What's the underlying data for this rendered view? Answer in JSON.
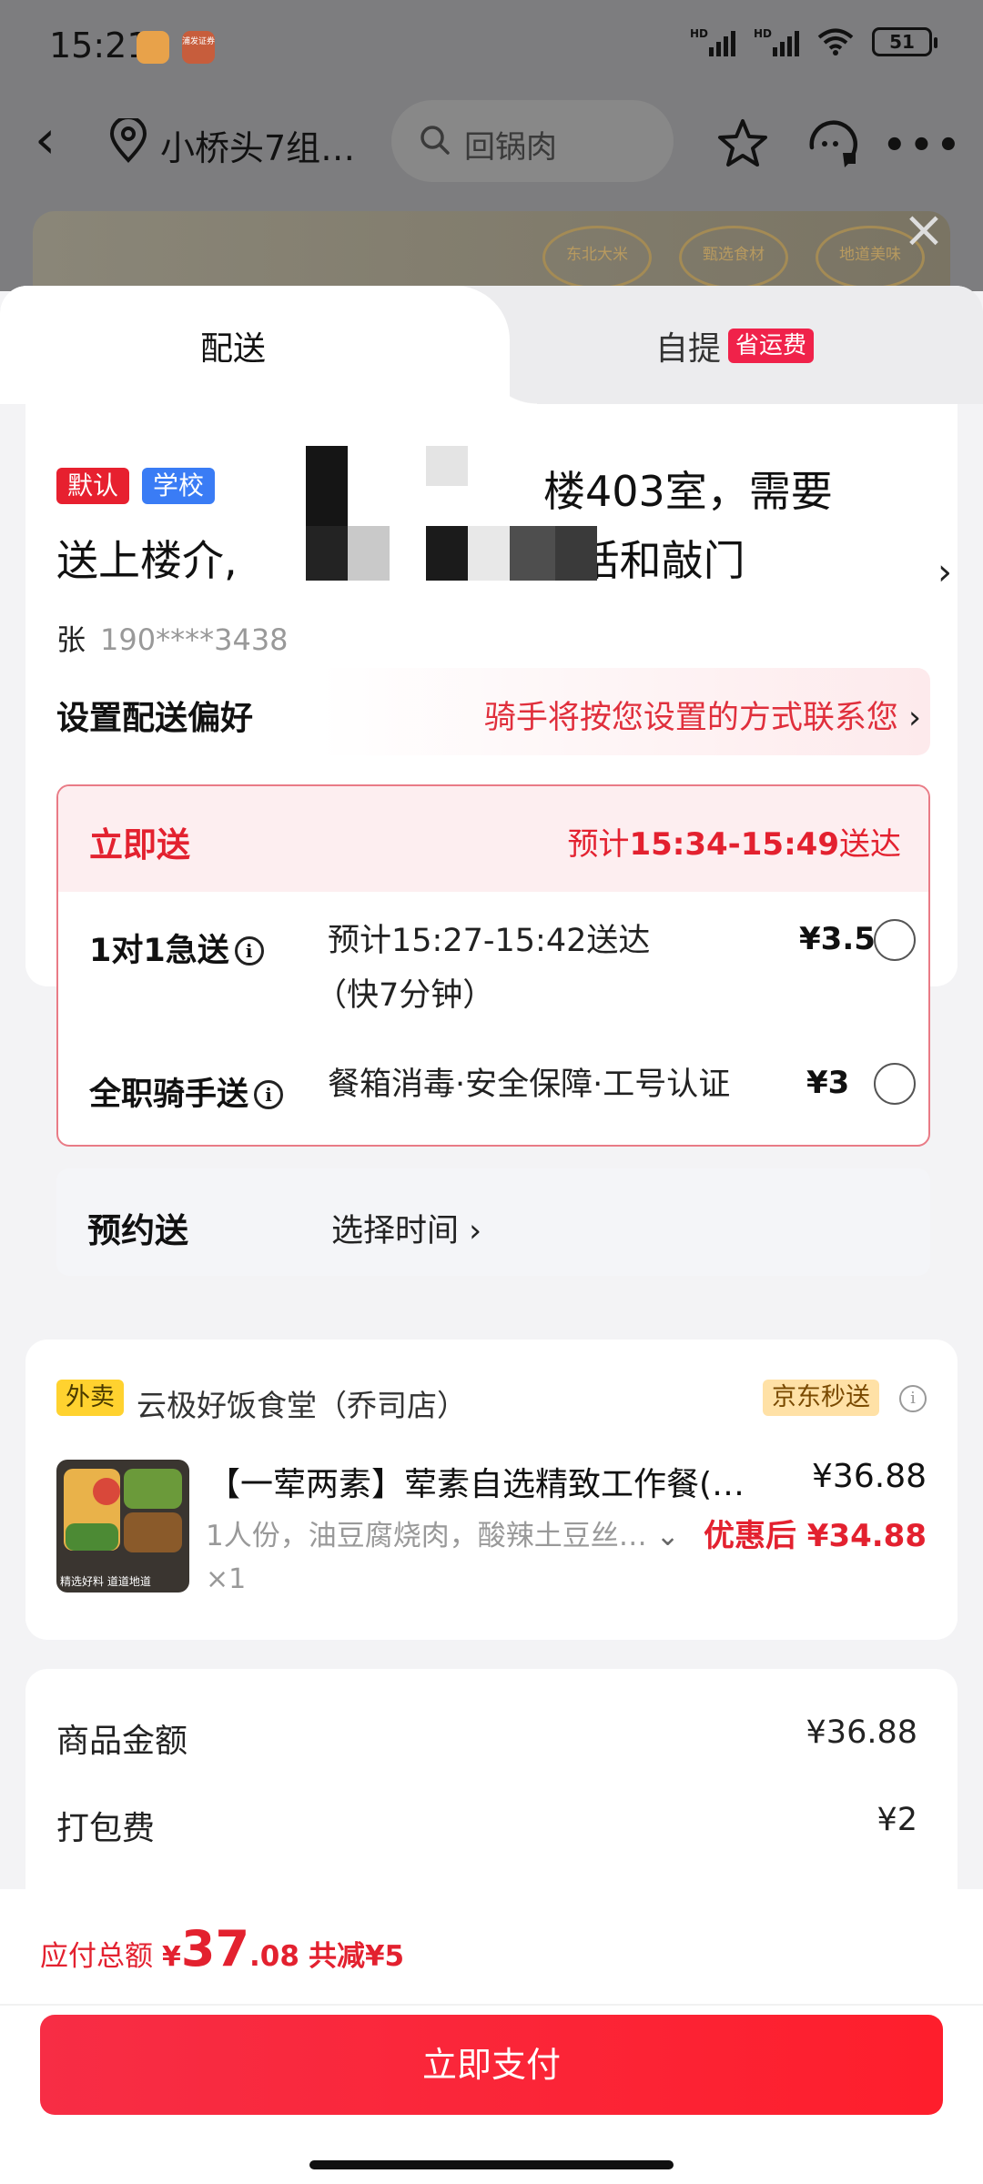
{
  "status_bar": {
    "time": "15:21",
    "app2_label": "浦发证券",
    "hd1": "HD",
    "hd2": "HD",
    "battery": "51"
  },
  "nav": {
    "location": "小桥头7组…",
    "search_placeholder": "回锅肉"
  },
  "banner": {
    "badges": [
      "东北大米",
      "甄选食材",
      "地道美味"
    ]
  },
  "tabs": {
    "delivery": "配送",
    "pickup": "自提",
    "pickup_tag": "省运费"
  },
  "address": {
    "tag_default": "默认",
    "tag_school": "学校",
    "line1_visible": "楼403室，需要",
    "line2_left": "送上楼介,",
    "line2_right": "别打电话和敲门",
    "contact_name": "张",
    "contact_phone": "190****3438"
  },
  "preference": {
    "title": "设置配送偏好",
    "value": "骑手将按您设置的方式联系您"
  },
  "instant": {
    "title": "立即送",
    "eta_prefix": "预计",
    "eta_time": "15:34-15:49",
    "eta_suffix": "送达",
    "options": [
      {
        "name": "1对1急送",
        "desc_line1": "预计15:27-15:42送达",
        "desc_line2": "（快7分钟）",
        "price": "¥3.5"
      },
      {
        "name": "全职骑手送",
        "desc_line1": "餐箱消毒·安全保障·工号认证",
        "price": "¥3"
      }
    ]
  },
  "schedule": {
    "title": "预约送",
    "value": "选择时间 ›"
  },
  "order": {
    "tag": "外卖",
    "shop": "云极好饭食堂（乔司店）",
    "service_tag": "京东秒送",
    "item_name": "【一荤两素】荤素自选精致工作餐(…",
    "item_price": "¥36.88",
    "item_spec": "1人份，油豆腐烧肉，酸辣土豆丝…",
    "item_after": "优惠后 ¥34.88",
    "item_qty": "×1",
    "image_caption": "精选好料  道道地道"
  },
  "fees": [
    {
      "label": "商品金额",
      "value": "¥36.88"
    },
    {
      "label": "打包费",
      "value": "¥2"
    }
  ],
  "footer": {
    "total_label": "应付总额",
    "currency": "¥",
    "total_int": "37",
    "total_dec": ".08",
    "total_save": "共减¥5",
    "pay_button": "立即支付"
  },
  "colors": {
    "accent_red": "#e3212f",
    "pay_button": "#f72d45",
    "tag_blue": "#3a7cf5",
    "tag_yellow": "#ffd22f"
  }
}
